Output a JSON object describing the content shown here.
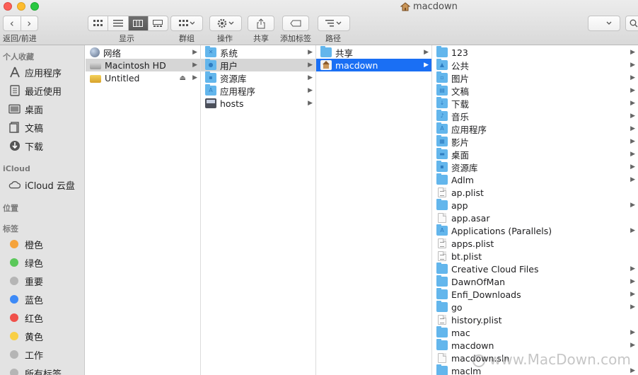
{
  "window": {
    "title": "macdown"
  },
  "toolbar": {
    "back_forward_label": "返回/前进",
    "view_label": "显示",
    "group_label": "群组",
    "action_label": "操作",
    "share_label": "共享",
    "tag_label": "添加标签",
    "path_label": "路径",
    "back_icon": "‹",
    "forward_icon": "›"
  },
  "sidebar": {
    "favorites_header": "个人收藏",
    "favorites": [
      {
        "label": "应用程序",
        "icon": "applications-icon"
      },
      {
        "label": "最近使用",
        "icon": "recents-icon"
      },
      {
        "label": "桌面",
        "icon": "desktop-icon"
      },
      {
        "label": "文稿",
        "icon": "documents-icon"
      },
      {
        "label": "下载",
        "icon": "downloads-icon"
      }
    ],
    "icloud_header": "iCloud",
    "icloud_item": "iCloud 云盘",
    "locations_header": "位置",
    "tags_header": "标签",
    "tags": [
      {
        "label": "橙色",
        "color": "#f5a33b"
      },
      {
        "label": "绿色",
        "color": "#5bc85a"
      },
      {
        "label": "重要",
        "color": "#b5b5b5"
      },
      {
        "label": "蓝色",
        "color": "#3d8af7"
      },
      {
        "label": "红色",
        "color": "#f0504a"
      },
      {
        "label": "黄色",
        "color": "#f8cf45"
      },
      {
        "label": "工作",
        "color": "#b5b5b5"
      },
      {
        "label": "所有标签",
        "color": "#b5b5b5"
      }
    ]
  },
  "columns": {
    "col1": [
      {
        "label": "网络",
        "icon": "network-globe-icon",
        "arrow": true
      },
      {
        "label": "Macintosh HD",
        "icon": "hard-drive-icon",
        "arrow": true,
        "selected": "gray"
      },
      {
        "label": "Untitled",
        "icon": "external-drive-icon",
        "arrow": true,
        "eject": true
      }
    ],
    "col2": [
      {
        "label": "系统",
        "icon": "folder-icon",
        "arrow": true
      },
      {
        "label": "用户",
        "icon": "folder-icon",
        "arrow": true,
        "selected": "gray"
      },
      {
        "label": "资源库",
        "icon": "folder-icon",
        "arrow": true
      },
      {
        "label": "应用程序",
        "icon": "folder-icon",
        "arrow": true
      },
      {
        "label": "hosts",
        "icon": "terminal-file-icon",
        "arrow": true
      }
    ],
    "col3": [
      {
        "label": "共享",
        "icon": "folder-icon",
        "arrow": true
      },
      {
        "label": "macdown",
        "icon": "home-folder-icon",
        "arrow": true,
        "selected": "blue"
      }
    ],
    "col4": [
      {
        "label": "123",
        "icon": "folder-icon",
        "arrow": true
      },
      {
        "label": "公共",
        "icon": "folder-icon",
        "arrow": true
      },
      {
        "label": "图片",
        "icon": "folder-icon",
        "arrow": true
      },
      {
        "label": "文稿",
        "icon": "folder-icon",
        "arrow": true
      },
      {
        "label": "下载",
        "icon": "folder-icon",
        "arrow": true
      },
      {
        "label": "音乐",
        "icon": "folder-icon",
        "arrow": true
      },
      {
        "label": "应用程序",
        "icon": "folder-icon",
        "arrow": true
      },
      {
        "label": "影片",
        "icon": "folder-icon",
        "arrow": true
      },
      {
        "label": "桌面",
        "icon": "folder-icon",
        "arrow": true
      },
      {
        "label": "资源库",
        "icon": "folder-icon",
        "arrow": true
      },
      {
        "label": "Adlm",
        "icon": "folder-icon",
        "arrow": true
      },
      {
        "label": "ap.plist",
        "icon": "plist-file-icon",
        "arrow": false
      },
      {
        "label": "app",
        "icon": "folder-icon",
        "arrow": true
      },
      {
        "label": "app.asar",
        "icon": "file-icon",
        "arrow": false
      },
      {
        "label": "Applications (Parallels)",
        "icon": "folder-icon",
        "arrow": true
      },
      {
        "label": "apps.plist",
        "icon": "plist-file-icon",
        "arrow": false
      },
      {
        "label": "bt.plist",
        "icon": "plist-file-icon",
        "arrow": false
      },
      {
        "label": "Creative Cloud Files",
        "icon": "folder-icon",
        "arrow": true
      },
      {
        "label": "DawnOfMan",
        "icon": "folder-icon",
        "arrow": true
      },
      {
        "label": "Enfi_Downloads",
        "icon": "folder-icon",
        "arrow": true
      },
      {
        "label": "go",
        "icon": "folder-icon",
        "arrow": true
      },
      {
        "label": "history.plist",
        "icon": "plist-file-icon",
        "arrow": false
      },
      {
        "label": "mac",
        "icon": "folder-icon",
        "arrow": true
      },
      {
        "label": "macdown",
        "icon": "folder-icon",
        "arrow": true
      },
      {
        "label": "macdown.sln",
        "icon": "file-icon",
        "arrow": false
      },
      {
        "label": "maclm",
        "icon": "folder-icon",
        "arrow": true
      }
    ]
  },
  "watermark": "www.MacDown.com"
}
